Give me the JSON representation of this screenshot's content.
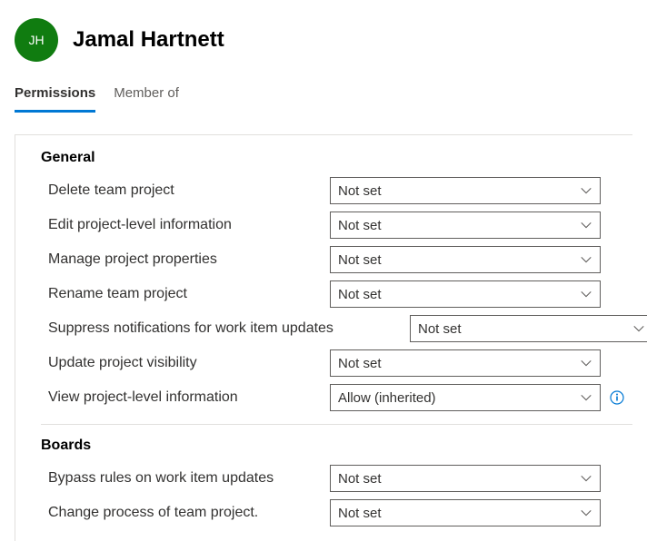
{
  "user": {
    "initials": "JH",
    "name": "Jamal Hartnett"
  },
  "tabs": [
    {
      "label": "Permissions",
      "active": true
    },
    {
      "label": "Member of",
      "active": false
    }
  ],
  "sections": [
    {
      "title": "General",
      "permissions": [
        {
          "label": "Delete team project",
          "value": "Not set",
          "wide": false,
          "info": false
        },
        {
          "label": "Edit project-level information",
          "value": "Not set",
          "wide": false,
          "info": false
        },
        {
          "label": "Manage project properties",
          "value": "Not set",
          "wide": false,
          "info": false
        },
        {
          "label": "Rename team project",
          "value": "Not set",
          "wide": false,
          "info": false
        },
        {
          "label": "Suppress notifications for work item updates",
          "value": "Not set",
          "wide": true,
          "info": false
        },
        {
          "label": "Update project visibility",
          "value": "Not set",
          "wide": false,
          "info": false
        },
        {
          "label": "View project-level information",
          "value": "Allow (inherited)",
          "wide": false,
          "info": true
        }
      ]
    },
    {
      "title": "Boards",
      "permissions": [
        {
          "label": "Bypass rules on work item updates",
          "value": "Not set",
          "wide": false,
          "info": false
        },
        {
          "label": "Change process of team project.",
          "value": "Not set",
          "wide": false,
          "info": false
        }
      ]
    }
  ]
}
